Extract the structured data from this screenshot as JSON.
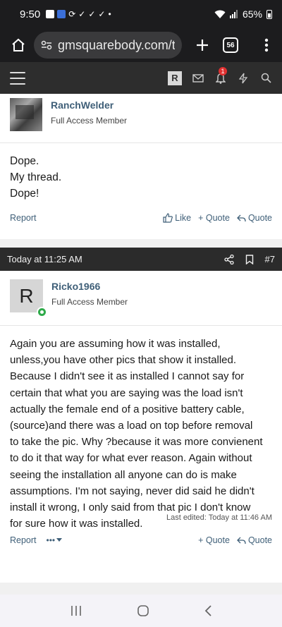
{
  "status_bar": {
    "time": "9:50",
    "battery": "65%"
  },
  "browser": {
    "url": "gmsquarebody.com/th",
    "tab_count": "56"
  },
  "site_nav": {
    "avatar_letter": "R",
    "alert_badge": "1"
  },
  "posts": [
    {
      "username": "RanchWelder",
      "user_title": "Full Access Member",
      "body": [
        "Dope.",
        "My thread.",
        "Dope!"
      ],
      "report_label": "Report",
      "like_label": "Like",
      "quote_label": "+ Quote",
      "reply_label": "Quote"
    },
    {
      "header_time": "Today at 11:25 AM",
      "post_number": "#7",
      "avatar_letter": "R",
      "username": "Ricko1966",
      "user_title": "Full Access Member",
      "body": [
        "Again you are assuming how it was installed,",
        "unless,you have other pics that show it installed.",
        "Because I didn't see it as installed I cannot say for",
        "certain that what you are saying was the load isn't",
        "actually the female end of a positive battery cable,",
        "(source)and there was a load on top before removal",
        "to take the pic. Why ?because it was more convienent",
        "to do it that way for what ever reason. Again without",
        "seeing the installation all anyone can do is make",
        "assumptions. I'm not saying, never did said he didn't",
        "install it wrong, I only said from that pic I don't know",
        "for sure how it was installed."
      ],
      "last_edited": "Last edited: Today at 11:46 AM",
      "report_label": "Report",
      "more_label": "•••",
      "quote_label": "+ Quote",
      "reply_label": "Quote"
    }
  ]
}
